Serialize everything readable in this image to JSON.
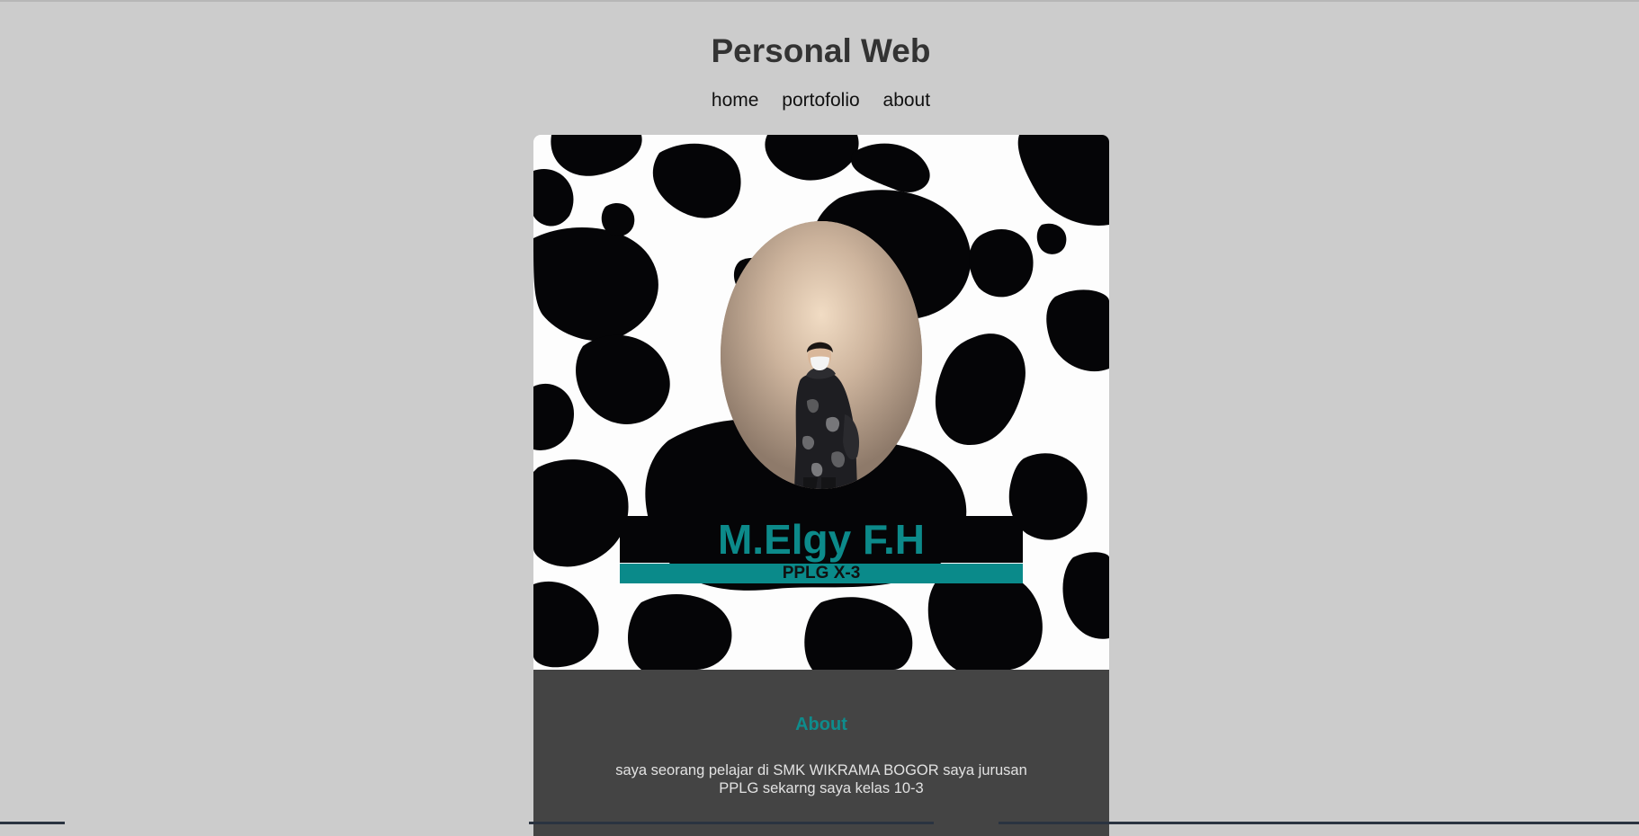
{
  "site": {
    "title": "Personal Web"
  },
  "nav": {
    "items": [
      {
        "label": "home"
      },
      {
        "label": "portofolio"
      },
      {
        "label": "about"
      }
    ]
  },
  "profile": {
    "name": "M.Elgy F.H",
    "class_label": "PPLG X-3",
    "photo_icon": "profile-photo",
    "accent_color": "#0c8a8a"
  },
  "about": {
    "title": "About",
    "text": "saya seorang pelajar di SMK WIKRAMA BOGOR saya jurusan PPLG sekarng saya kelas 10-3"
  },
  "colors": {
    "page_background": "#cccccc",
    "about_background": "#444444",
    "accent": "#0c8a8a",
    "cow_pattern_dark": "#050507",
    "cow_pattern_light": "#fdfdfd"
  }
}
